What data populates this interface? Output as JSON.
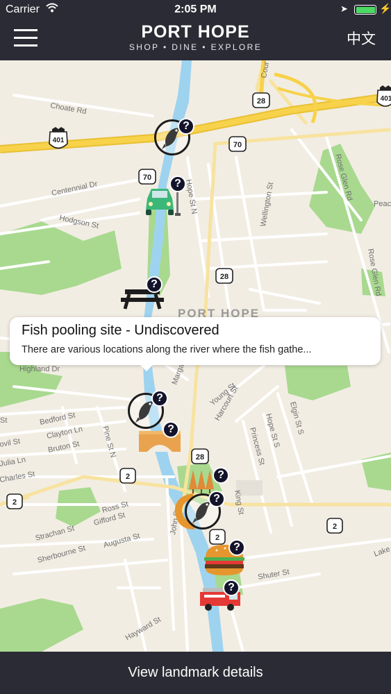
{
  "status_bar": {
    "carrier": "Carrier",
    "time": "2:05 PM",
    "battery_level": 1.0,
    "battery_color": "#4cd964"
  },
  "nav": {
    "title": "PORT HOPE",
    "subtitle": "SHOP • DINE • EXPLORE",
    "language_button": "中文",
    "menu_icon": "hamburger-icon",
    "background": "#2b2b35"
  },
  "map": {
    "town_label": "PORT HOPE",
    "road_labels": {
      "choate": "Choate Rd",
      "centennial": "Centennial Dr",
      "hodgson": "Hodgson St",
      "rose_glen_1": "Rose Glen Rd",
      "rose_glen_2": "Rose Glen Rd",
      "wellington": "Wellington St",
      "hope_n": "Hope St N",
      "peac": "Peac",
      "highland": "Highland Dr",
      "marga": "Marga",
      "young": "Young St",
      "harcourt": "Harcourt St",
      "elgin": "Elgin St S",
      "princess": "Princess St",
      "hope_s": "Hope St S",
      "bedford": "Bedford St",
      "clayton": "Clayton Ln",
      "bruton": "Bruton St",
      "pine": "Pine St N",
      "julia": "Julia Ln",
      "charles": "Charles St",
      "ovil": "ovil St",
      "st": "St",
      "ross": "Ross St",
      "gifford": "Gifford St",
      "strachan": "Strachan St",
      "sherbourne": "Sherbourne St",
      "augusta": "Augusta St",
      "john": "John St",
      "king": "King St",
      "shuter": "Shuter St",
      "hayward": "Hayward St",
      "lake": "Lake",
      "cour": "Cour"
    },
    "route_shields": [
      "401",
      "401",
      "28",
      "70",
      "70",
      "28",
      "28",
      "2",
      "2",
      "2",
      "2"
    ],
    "markers": [
      {
        "name": "fish-pooling-marker-north",
        "icon": "fish-icon"
      },
      {
        "name": "parking-marker",
        "icon": "car-icon"
      },
      {
        "name": "picnic-marker",
        "icon": "picnic-table-icon"
      },
      {
        "name": "fish-pooling-marker-selected",
        "icon": "fish-icon"
      },
      {
        "name": "bridge-marker",
        "icon": "bridge-icon"
      },
      {
        "name": "park-marker",
        "icon": "trees-icon"
      },
      {
        "name": "fish-pooling-marker-south",
        "icon": "fish-icon"
      },
      {
        "name": "burger-marker",
        "icon": "burger-icon"
      },
      {
        "name": "fire-truck-marker",
        "icon": "fire-truck-icon"
      }
    ],
    "badge_text": "?",
    "colors": {
      "land": "#f2ede3",
      "park": "#a8d98f",
      "water": "#9ed3f0",
      "highway": "#f7d24a",
      "road": "#ffffff"
    }
  },
  "callout": {
    "title": "Fish pooling site - Undiscovered",
    "description": "There are various locations along the river where the fish gathe..."
  },
  "bottom_button": {
    "label": "View landmark details"
  }
}
